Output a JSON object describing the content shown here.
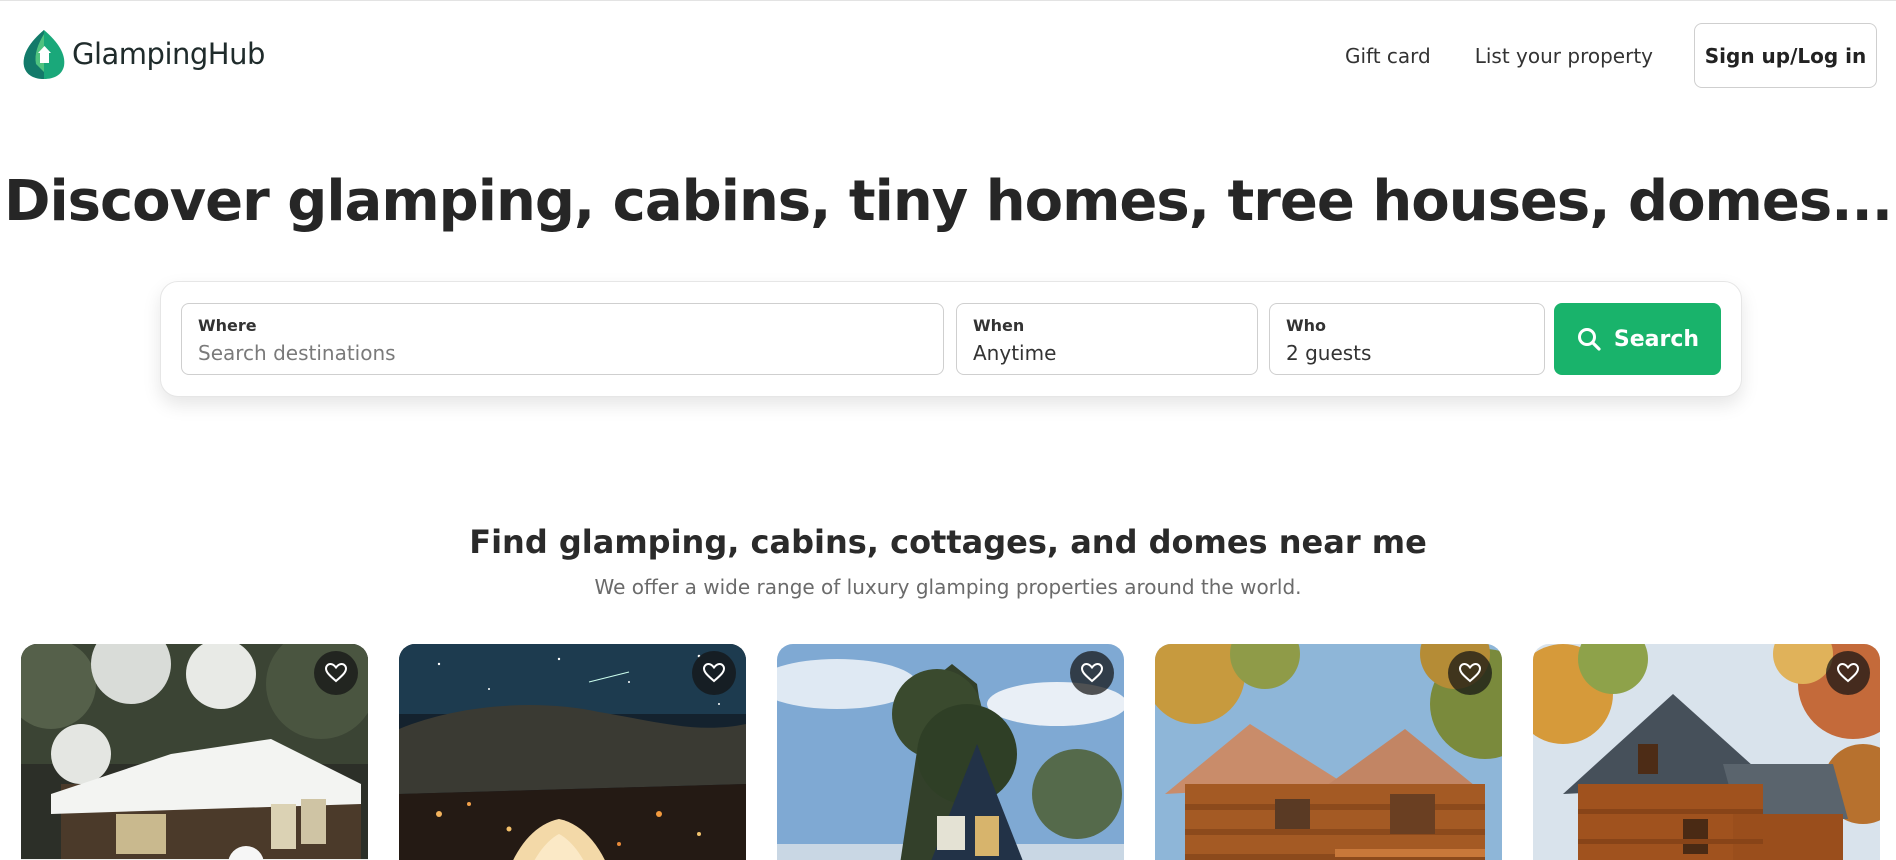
{
  "brand": {
    "name": "GlampingHub",
    "accent": "#19b36b"
  },
  "nav": {
    "gift_card": "Gift card",
    "list_property": "List your property",
    "login": "Sign up/Log in"
  },
  "hero": {
    "title": "Discover glamping, cabins, tiny homes, tree houses, domes..."
  },
  "search": {
    "where_label": "Where",
    "where_placeholder": "Search destinations",
    "when_label": "When",
    "when_value": "Anytime",
    "who_label": "Who",
    "who_value": "2 guests",
    "button": "Search",
    "icon": "search-icon"
  },
  "section": {
    "title": "Find glamping, cabins, cottages, and domes near me",
    "subtitle": "We offer a wide range of luxury glamping properties around the world."
  },
  "cards": [
    {
      "scene": "snowy-cabin",
      "favorite_icon": "heart-icon"
    },
    {
      "scene": "night-tent",
      "favorite_icon": "heart-icon"
    },
    {
      "scene": "a-frame-cabin",
      "favorite_icon": "heart-icon"
    },
    {
      "scene": "log-cabin",
      "favorite_icon": "heart-icon"
    },
    {
      "scene": "autumn-cabin",
      "favorite_icon": "heart-icon"
    }
  ]
}
